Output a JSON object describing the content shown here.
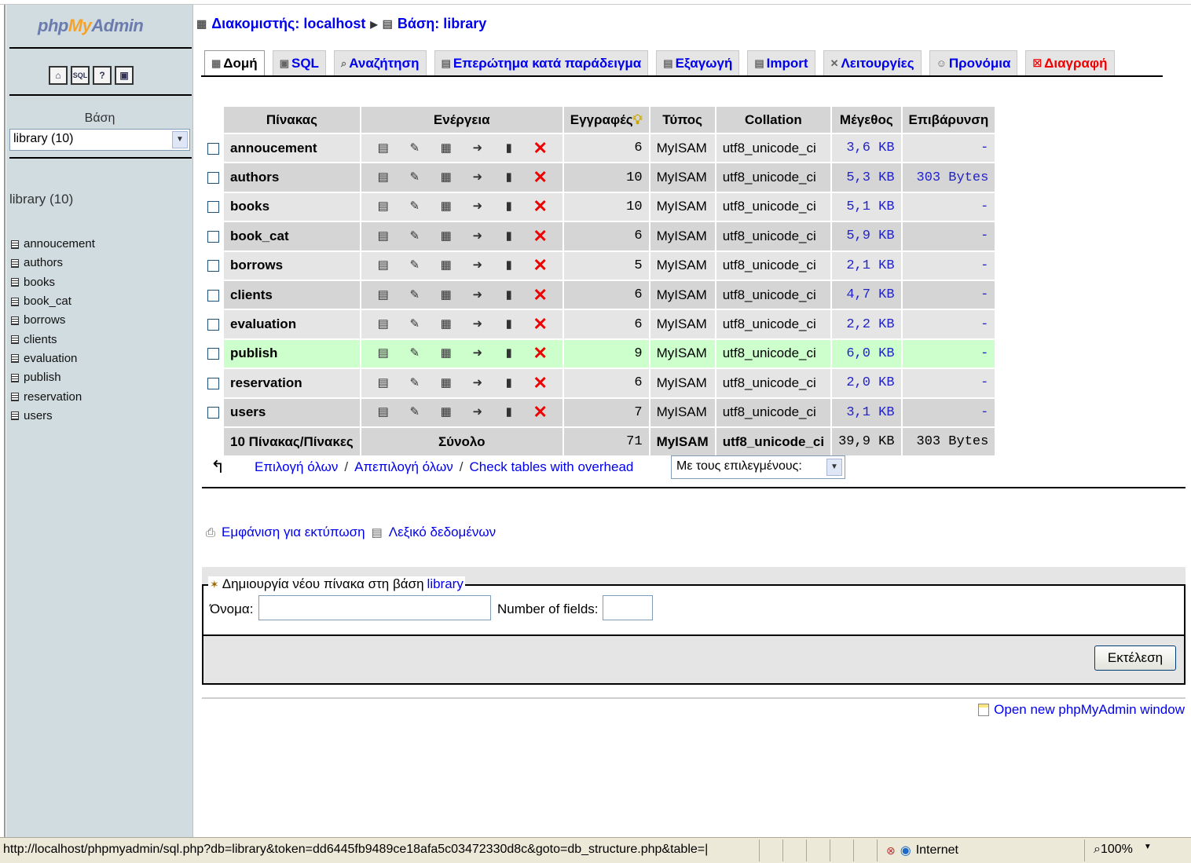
{
  "sidebar": {
    "logo": {
      "php": "php",
      "my": "My",
      "admin": "Admin"
    },
    "quick_icons": [
      "home-icon",
      "sql-query-icon",
      "docs-icon",
      "help-icon"
    ],
    "quick_icon_glyphs": [
      "⌂",
      "SQL",
      "?",
      "▣"
    ],
    "db_label": "Βάση",
    "db_select": "library (10)",
    "db_heading": "library (10)",
    "tables": [
      "annoucement",
      "authors",
      "books",
      "book_cat",
      "borrows",
      "clients",
      "evaluation",
      "publish",
      "reservation",
      "users"
    ]
  },
  "breadcrumb": {
    "server": "Διακομιστής: localhost",
    "db": "Βάση: library"
  },
  "tabs": [
    {
      "label": "Δομή",
      "icon": "structure-icon"
    },
    {
      "label": "SQL",
      "icon": "sql-icon"
    },
    {
      "label": "Αναζήτηση",
      "icon": "search-icon"
    },
    {
      "label": "Επερώτημα κατά παράδειγμα",
      "icon": "query-icon"
    },
    {
      "label": "Εξαγωγή",
      "icon": "export-icon"
    },
    {
      "label": "Import",
      "icon": "import-icon"
    },
    {
      "label": "Λειτουργίες",
      "icon": "operations-icon"
    },
    {
      "label": "Προνόμια",
      "icon": "privileges-icon"
    },
    {
      "label": "Διαγραφή",
      "icon": "drop-icon"
    }
  ],
  "table": {
    "headers": {
      "table": "Πίνακας",
      "action": "Ενέργεια",
      "records": "Εγγραφές",
      "type": "Τύπος",
      "collation": "Collation",
      "size": "Μέγεθος",
      "overhead": "Επιβάρυνση"
    },
    "action_icons": [
      "browse-icon",
      "structure-icon",
      "search-icon",
      "insert-icon",
      "empty-icon",
      "drop-icon"
    ],
    "rows": [
      {
        "name": "annoucement",
        "records": "6",
        "type": "MyISAM",
        "collation": "utf8_unicode_ci",
        "size": "3,6 KB",
        "overhead": "-"
      },
      {
        "name": "authors",
        "records": "10",
        "type": "MyISAM",
        "collation": "utf8_unicode_ci",
        "size": "5,3 KB",
        "overhead": "303 Bytes"
      },
      {
        "name": "books",
        "records": "10",
        "type": "MyISAM",
        "collation": "utf8_unicode_ci",
        "size": "5,1 KB",
        "overhead": "-"
      },
      {
        "name": "book_cat",
        "records": "6",
        "type": "MyISAM",
        "collation": "utf8_unicode_ci",
        "size": "5,9 KB",
        "overhead": "-"
      },
      {
        "name": "borrows",
        "records": "5",
        "type": "MyISAM",
        "collation": "utf8_unicode_ci",
        "size": "2,1 KB",
        "overhead": "-"
      },
      {
        "name": "clients",
        "records": "6",
        "type": "MyISAM",
        "collation": "utf8_unicode_ci",
        "size": "4,7 KB",
        "overhead": "-"
      },
      {
        "name": "evaluation",
        "records": "6",
        "type": "MyISAM",
        "collation": "utf8_unicode_ci",
        "size": "2,2 KB",
        "overhead": "-"
      },
      {
        "name": "publish",
        "records": "9",
        "type": "MyISAM",
        "collation": "utf8_unicode_ci",
        "size": "6,0 KB",
        "overhead": "-"
      },
      {
        "name": "reservation",
        "records": "6",
        "type": "MyISAM",
        "collation": "utf8_unicode_ci",
        "size": "2,0 KB",
        "overhead": "-"
      },
      {
        "name": "users",
        "records": "7",
        "type": "MyISAM",
        "collation": "utf8_unicode_ci",
        "size": "3,1 KB",
        "overhead": "-"
      }
    ],
    "highlighted_row": "publish",
    "total": {
      "label": "10 Πίνακας/Πίνακες",
      "sum_label": "Σύνολο",
      "records": "71",
      "type": "MyISAM",
      "collation": "utf8_unicode_ci",
      "size": "39,9 KB",
      "overhead": "303 Bytes"
    }
  },
  "bulk": {
    "select_all": "Επιλογή όλων",
    "deselect_all": "Απεπιλογή όλων",
    "check_overhead": "Check tables with overhead",
    "with_selected": "Με τους επιλεγμένους:"
  },
  "links": {
    "print_view": "Εμφάνιση για εκτύπωση",
    "data_dictionary": "Λεξικό δεδομένων"
  },
  "create": {
    "legend": "Δημιουργία νέου πίνακα στη βάση",
    "legend_db": "library",
    "name_label": "Όνομα:",
    "name_value": "",
    "fields_label": "Number of fields:",
    "fields_value": "",
    "go": "Εκτέλεση"
  },
  "open_new_window": "Open new phpMyAdmin window",
  "statusbar": {
    "url": "http://localhost/phpmyadmin/sql.php?db=library&token=dd6445fb9489ce18afa5c03472330d8c&goto=db_structure.php&table=|",
    "zone": "Internet",
    "zoom": "100%"
  }
}
